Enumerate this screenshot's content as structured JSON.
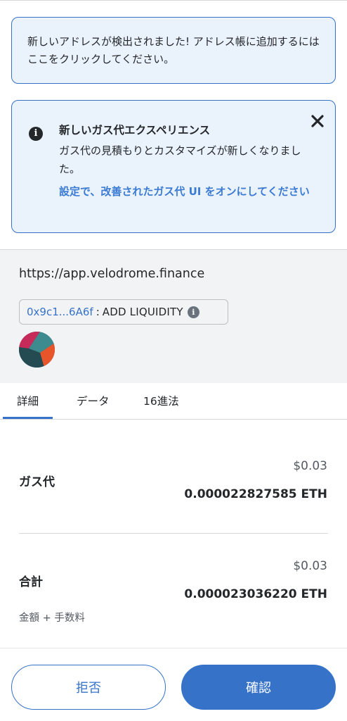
{
  "new_address_banner": {
    "text": "新しいアドレスが検出されました! アドレス帳に追加するにはここをクリックしてください。"
  },
  "gas_banner": {
    "title": "新しいガス代エクスペリエンス",
    "description": "ガス代の見積もりとカスタマイズが新しくなりました。",
    "link": "設定で、改善されたガス代 UI をオンにしてください"
  },
  "origin": {
    "url": "https://app.velodrome.finance",
    "contract_address": "0x9c1...6A6f",
    "separator": ":",
    "method": "ADD LIQUIDITY"
  },
  "tabs": [
    "詳細",
    "データ",
    "16進法"
  ],
  "gas_fee": {
    "label": "ガス代",
    "usd": "$0.03",
    "eth": "0.000022827585 ETH"
  },
  "total": {
    "label": "合計",
    "usd": "$0.03",
    "eth": "0.000023036220 ETH",
    "sublabel": "金額 + 手数料"
  },
  "buttons": {
    "reject": "拒否",
    "confirm": "確認"
  },
  "colors": {
    "accent": "#3772c9",
    "banner_bg": "#eaf2fc",
    "origin_bg": "#f2f3f4"
  }
}
